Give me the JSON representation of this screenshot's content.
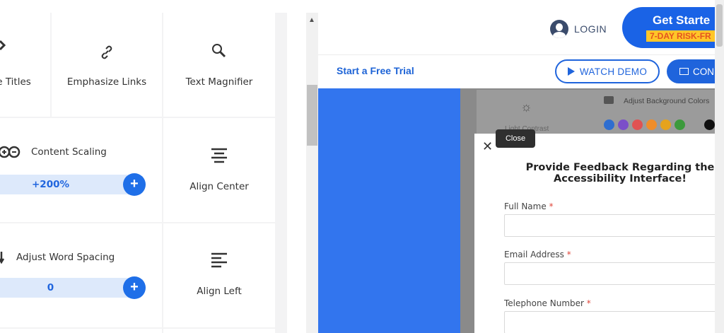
{
  "a11y_panel": {
    "tiles": {
      "titles": "ze Titles",
      "links": "Emphasize Links",
      "magnifier": "Text Magnifier",
      "scaling": "Content Scaling",
      "scaling_value": "+200%",
      "center": "Align Center",
      "word_spacing": "Adjust Word Spacing",
      "word_spacing_value": "0",
      "left": "Align Left"
    },
    "plus_label": "+"
  },
  "site": {
    "login": "LOGIN",
    "get_started": "Get Starte",
    "risk_badge": "7-DAY RISK-FR",
    "trial_link": "Start a Free Trial",
    "watch_demo": "WATCH DEMO",
    "contact": "CON"
  },
  "background_widget": {
    "faded_label": "Light Contrast",
    "adjust_label": "Adjust Background Colors",
    "swatches": [
      "#2f6ed0",
      "#7b4fc9",
      "#e05252",
      "#ef8d2b",
      "#e6a31d",
      "#3c9a3c",
      "#111111"
    ]
  },
  "feedback_modal": {
    "close_tooltip": "Close",
    "close_symbol": "✕",
    "title": "Provide Feedback Regarding the Accessibility Interface!",
    "fields": [
      {
        "label": "Full Name",
        "required": "*"
      },
      {
        "label": "Email Address",
        "required": "*"
      },
      {
        "label": "Telephone Number",
        "required": "*"
      }
    ]
  }
}
